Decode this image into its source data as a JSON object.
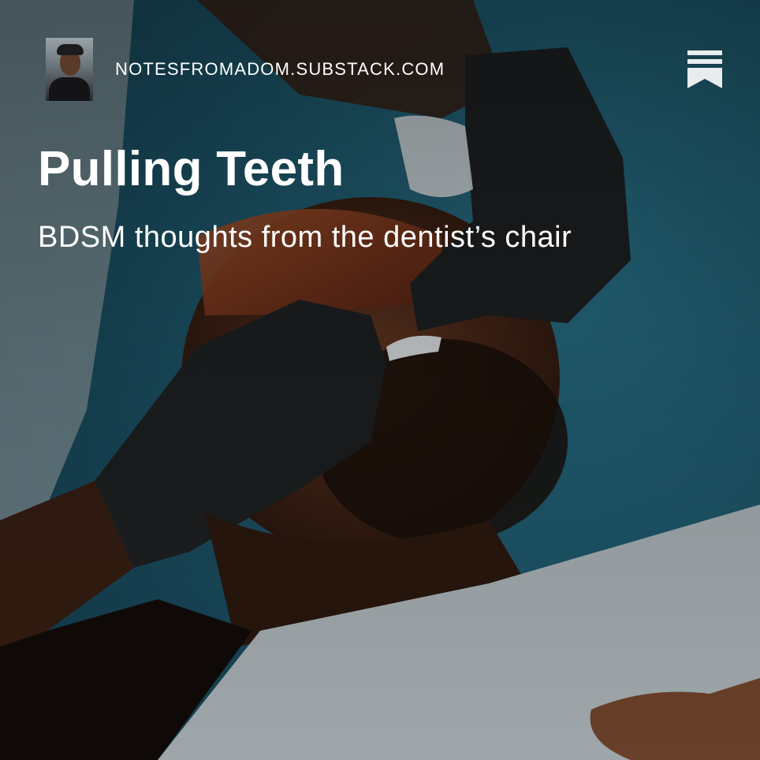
{
  "publication": {
    "domain": "NOTESFROMADOM.SUBSTACK.COM",
    "avatar_icon": "author-avatar",
    "brand_icon": "substack-bookmark-icon"
  },
  "post": {
    "title": "Pulling Teeth",
    "subtitle": "BDSM thoughts from the dentist’s chair"
  },
  "colors": {
    "background_teal": "#1e5c70",
    "text": "#ffffff",
    "glove": "#1f2224",
    "skin": "#4a2a1c",
    "bib": "#b9c3c7"
  }
}
